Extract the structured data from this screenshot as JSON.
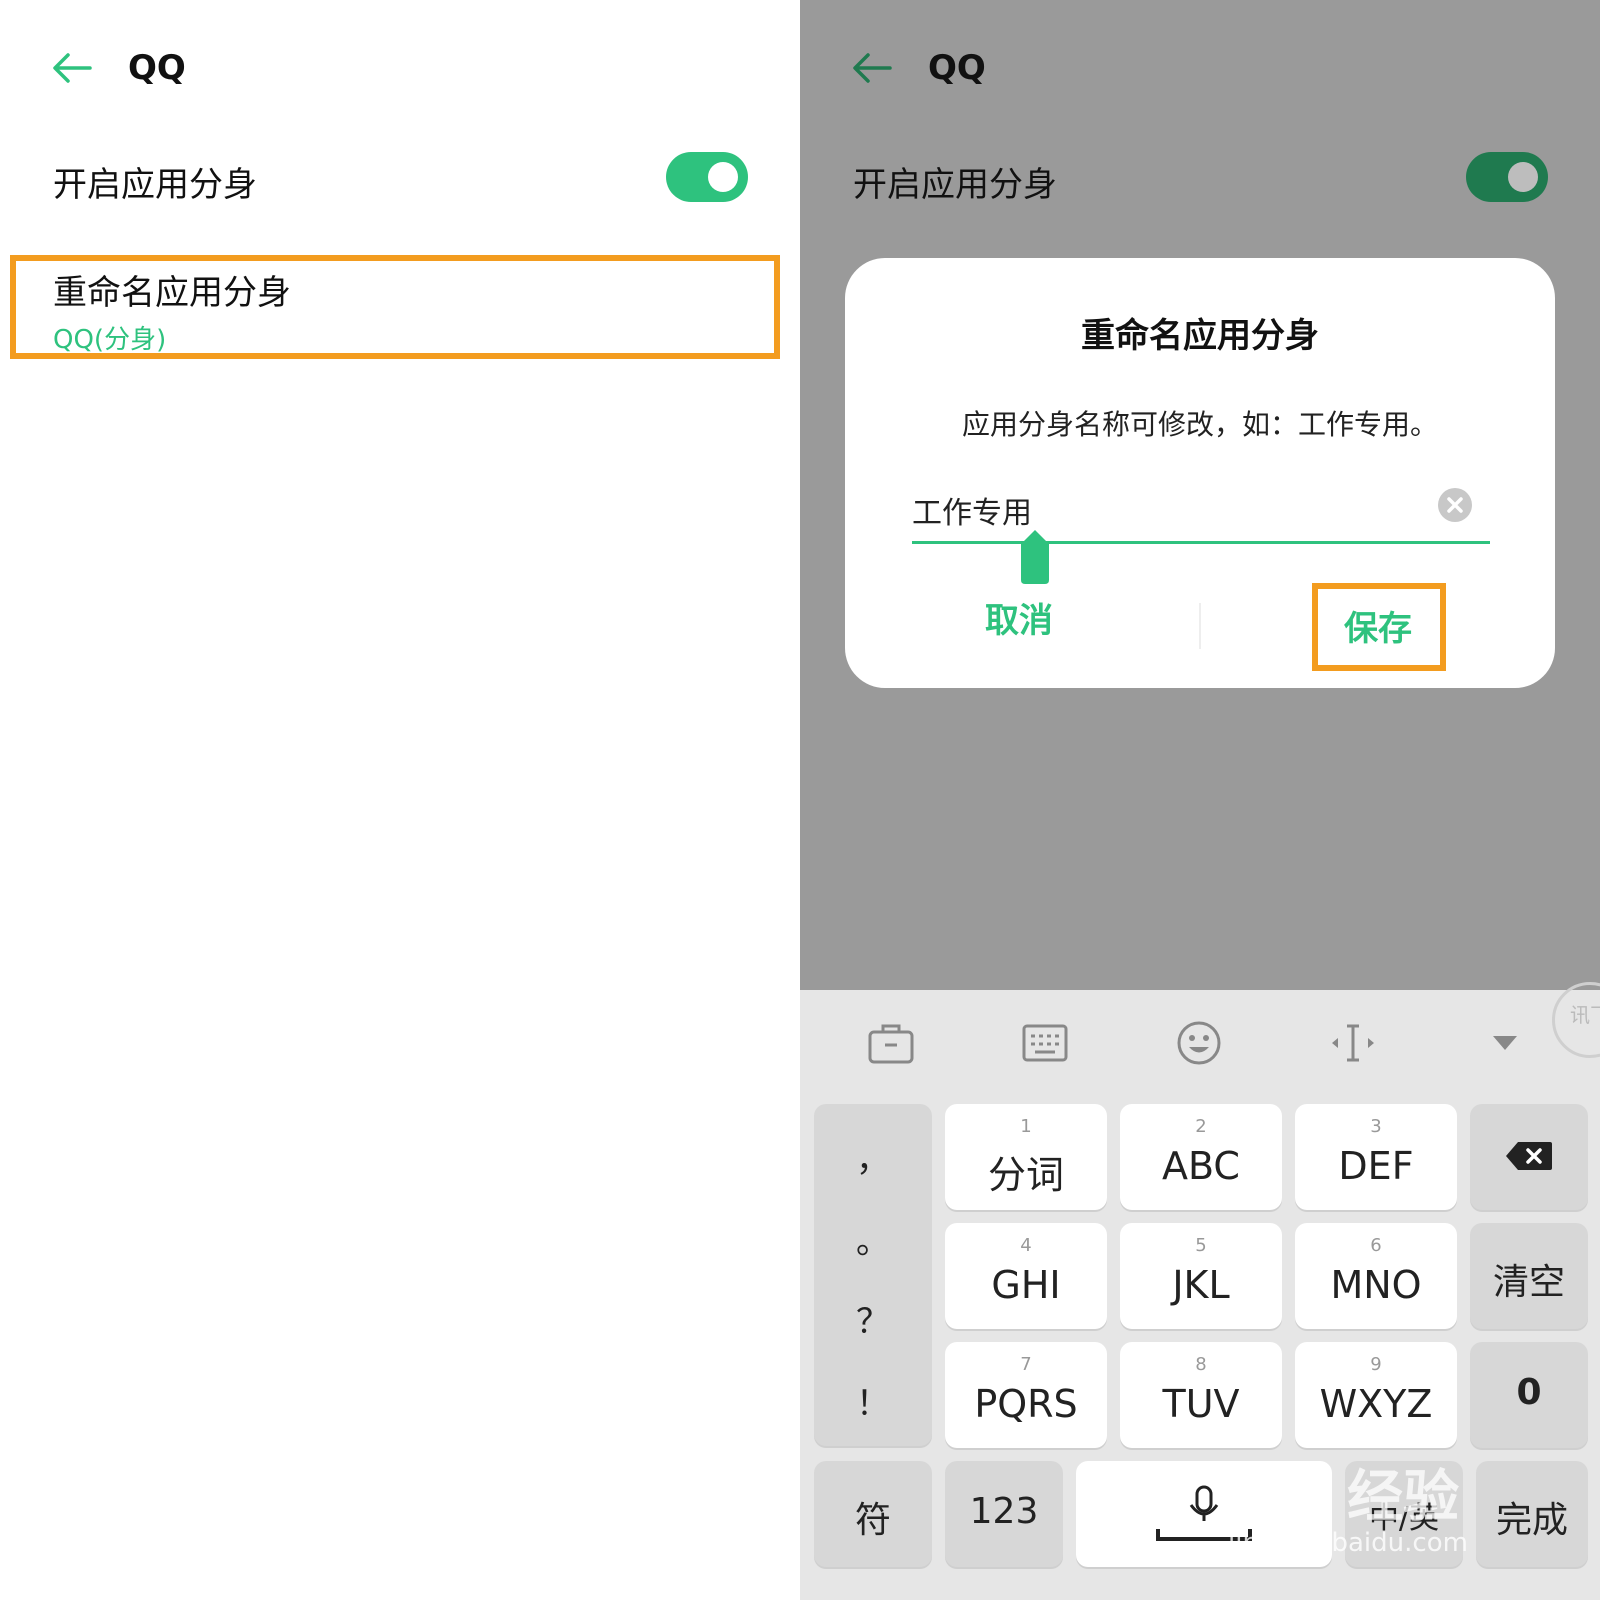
{
  "left_screen": {
    "title": "QQ",
    "toggle_row": {
      "label": "开启应用分身",
      "enabled": true
    },
    "rename_row": {
      "label": "重命名应用分身",
      "value": "QQ(分身)"
    }
  },
  "right_screen": {
    "title": "QQ",
    "toggle_row": {
      "label": "开启应用分身",
      "enabled": true
    },
    "dialog": {
      "title": "重命名应用分身",
      "description": "应用分身名称可修改，如：工作专用。",
      "input_value": "工作专用",
      "cancel_label": "取消",
      "save_label": "保存"
    },
    "keyboard": {
      "toolbar": [
        "toolbox-icon",
        "keyboard-icon",
        "emoji-icon",
        "cursor-move-icon",
        "collapse-icon"
      ],
      "punctuation": [
        "，",
        "。",
        "？",
        "！"
      ],
      "keys": [
        {
          "num": "1",
          "label": "分词"
        },
        {
          "num": "2",
          "label": "ABC"
        },
        {
          "num": "3",
          "label": "DEF"
        },
        {
          "num": "4",
          "label": "GHI"
        },
        {
          "num": "5",
          "label": "JKL"
        },
        {
          "num": "6",
          "label": "MNO"
        },
        {
          "num": "7",
          "label": "PQRS"
        },
        {
          "num": "8",
          "label": "TUV"
        },
        {
          "num": "9",
          "label": "WXYZ"
        }
      ],
      "clear_label": "清空",
      "zero_label": "0",
      "symbols_label": "符",
      "numbers_label": "123",
      "lang_label": "中/英",
      "done_label": "完成"
    }
  },
  "watermark": {
    "brand": "Bai 经验",
    "url": "jingyan.baidu.com",
    "badge": "讯飞"
  },
  "colors": {
    "accent": "#2ec27e",
    "highlight": "#f39c1f",
    "overlay": "#9a9a9a"
  }
}
